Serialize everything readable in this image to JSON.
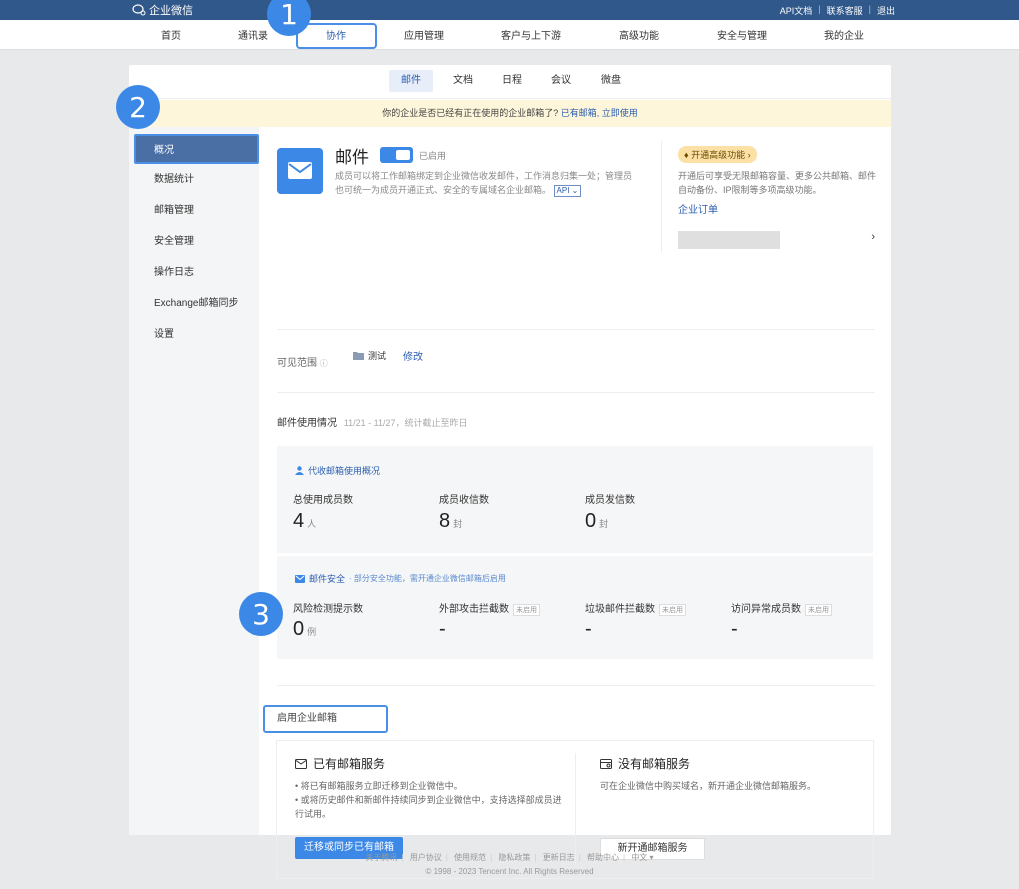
{
  "topbar": {
    "logo_text": "企业微信",
    "links": [
      "API文档",
      "联系客服",
      "退出"
    ]
  },
  "nav": {
    "items": [
      "首页",
      "通讯录",
      "协作",
      "应用管理",
      "客户与上下游",
      "高级功能",
      "安全与管理",
      "我的企业"
    ],
    "active": "协作"
  },
  "badges": [
    "1",
    "2",
    "3"
  ],
  "subtabs": {
    "items": [
      "邮件",
      "文档",
      "日程",
      "会议",
      "微盘"
    ],
    "active": "邮件"
  },
  "notice": {
    "text": "你的企业是否已经有正在使用的企业邮箱了?",
    "link": "已有邮箱, 立即使用"
  },
  "sidebar": {
    "items": [
      "概况",
      "数据统计",
      "邮箱管理",
      "安全管理",
      "操作日志",
      "Exchange邮箱同步",
      "设置"
    ],
    "active": "概况"
  },
  "app": {
    "title": "邮件",
    "status": "已启用",
    "desc": "成员可以将工作邮箱绑定到企业微信收发邮件，工作消息归集一处；管理员也可统一为成员开通正式、安全的专属域名企业邮箱。",
    "api_label": "API"
  },
  "promo": {
    "tag": "开通高级功能 ›",
    "desc": "开通后可享受无限邮箱容量、更多公共邮箱、邮件自动备份、IP限制等多项高级功能。",
    "link": "企业订单",
    "arrow": "›"
  },
  "scope": {
    "label": "可见范围",
    "chip": "测试",
    "edit": "修改"
  },
  "usage": {
    "title": "邮件使用情况",
    "subtitle": "11/21 - 11/27，统计截止至昨日"
  },
  "proxy_panel": {
    "title": "代收邮箱使用概况",
    "stats": [
      {
        "label": "总使用成员数",
        "value": "4",
        "unit": "人"
      },
      {
        "label": "成员收信数",
        "value": "8",
        "unit": "封"
      },
      {
        "label": "成员发信数",
        "value": "0",
        "unit": "封"
      }
    ]
  },
  "security_panel": {
    "title": "邮件安全",
    "note": "· 部分安全功能，需开通企业微信邮箱后启用",
    "stats": [
      {
        "label": "风险检测提示数",
        "value": "0",
        "unit": "例",
        "tag": ""
      },
      {
        "label": "外部攻击拦截数",
        "value": "-",
        "unit": "",
        "tag": "未启用"
      },
      {
        "label": "垃圾邮件拦截数",
        "value": "-",
        "unit": "",
        "tag": "未启用"
      },
      {
        "label": "访问异常成员数",
        "value": "-",
        "unit": "",
        "tag": "未启用"
      }
    ]
  },
  "enable": {
    "label": "启用企业邮箱"
  },
  "services": {
    "existing": {
      "title": "已有邮箱服务",
      "bullets": [
        "• 将已有邮箱服务立即迁移到企业微信中。",
        "• 或将历史邮件和新邮件持续同步到企业微信中，支持选择部成员进行试用。"
      ],
      "button": "迁移或同步已有邮箱"
    },
    "none": {
      "title": "没有邮箱服务",
      "desc": "可在企业微信中购买域名，新开通企业微信邮箱服务。",
      "button": "新开通邮箱服务"
    }
  },
  "footer": {
    "links": [
      "关于腾讯",
      "用户协议",
      "使用规范",
      "隐私政策",
      "更新日志",
      "帮助中心",
      "中文 ▾"
    ],
    "copyright": "© 1998 - 2023 Tencent Inc. All Rights Reserved"
  },
  "colors": {
    "topbar": "#31588a",
    "accent": "#3c88e6",
    "highlight_border": "#4a8fe6",
    "notice_bg": "#fdf6da"
  }
}
